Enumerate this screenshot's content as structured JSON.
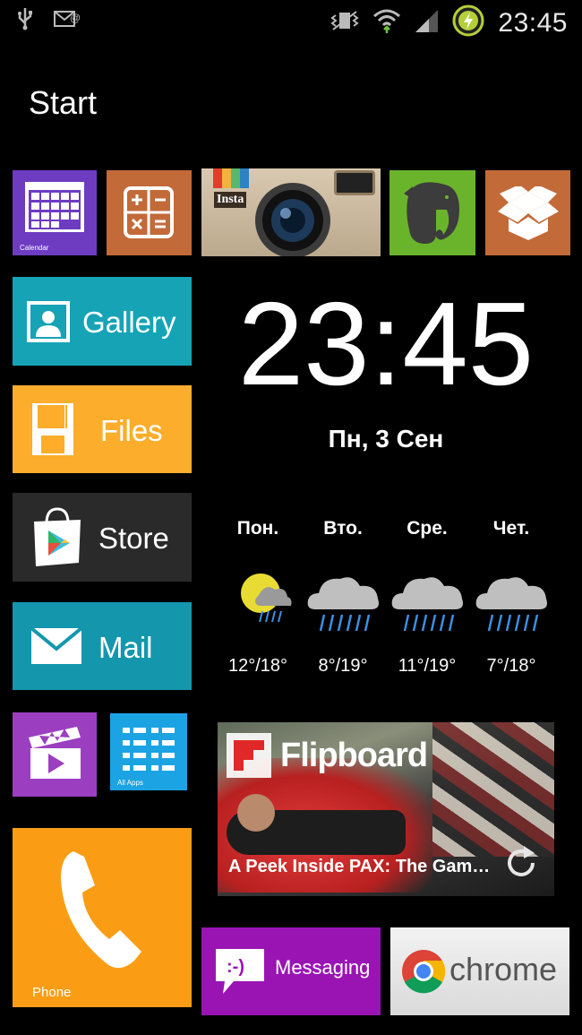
{
  "status_bar": {
    "time": "23:45",
    "icons": [
      "usb-icon",
      "email-icon",
      "vibrate-icon",
      "wifi-icon",
      "signal-icon",
      "battery-charging-icon"
    ]
  },
  "page": {
    "title": "Start"
  },
  "tiles": {
    "calendar": {
      "label": "Calendar",
      "color": "#6d3cc1"
    },
    "calculator": {
      "color": "#c26a38"
    },
    "instagram": {
      "label": "Insta"
    },
    "evernote": {
      "color": "#6ab42c"
    },
    "dropbox": {
      "color": "#c26a38"
    },
    "gallery": {
      "label": "Gallery",
      "color": "#16a3b6"
    },
    "files": {
      "label": "Files",
      "color": "#fcad2c"
    },
    "store": {
      "label": "Store",
      "color": "#2a2a2a"
    },
    "mail": {
      "label": "Mail",
      "color": "#1497ad"
    },
    "video": {
      "color": "#9b3fc0"
    },
    "all_apps": {
      "label": "All Apps",
      "color": "#1ca3e3"
    },
    "phone": {
      "label": "Phone",
      "color": "#fb9d14"
    },
    "messaging": {
      "label": "Messaging",
      "color": "#9a14b4"
    },
    "chrome": {
      "label": "chrome",
      "color": "#ececec"
    }
  },
  "clock": {
    "time": "23:45",
    "date": "Пн, 3 Сен"
  },
  "weather": {
    "days": [
      {
        "day": "Пон.",
        "temp": "12°/18°",
        "icon": "sun-cloud-rain-icon"
      },
      {
        "day": "Вто.",
        "temp": "8°/19°",
        "icon": "rain-cloud-icon"
      },
      {
        "day": "Сре.",
        "temp": "11°/19°",
        "icon": "rain-cloud-icon"
      },
      {
        "day": "Чет.",
        "temp": "7°/18°",
        "icon": "rain-cloud-icon"
      }
    ]
  },
  "flipboard": {
    "brand": "Flipboard",
    "caption": "A Peek Inside PAX: The Gam…"
  }
}
